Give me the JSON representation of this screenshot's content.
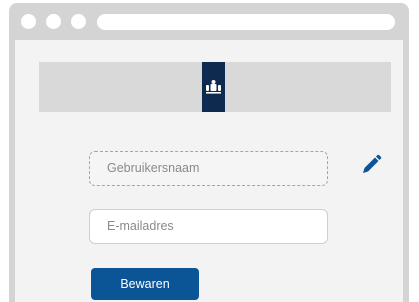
{
  "browser": {
    "window_controls": [
      "dot",
      "dot",
      "dot"
    ],
    "address_bar": ""
  },
  "header": {
    "logo_icon": "coat-of-arms-icon",
    "colors": {
      "band": "#d9d9d9",
      "logo": "#0f2a4f"
    }
  },
  "form": {
    "username": {
      "placeholder": "Gebruikersnaam"
    },
    "email": {
      "placeholder": "E-mailadres"
    },
    "edit_icon": "pencil-icon",
    "save_label": "Bewaren"
  },
  "colors": {
    "accent": "#0b5597",
    "window_frame": "#d4d4d4",
    "page_background": "#f3f3f3"
  }
}
